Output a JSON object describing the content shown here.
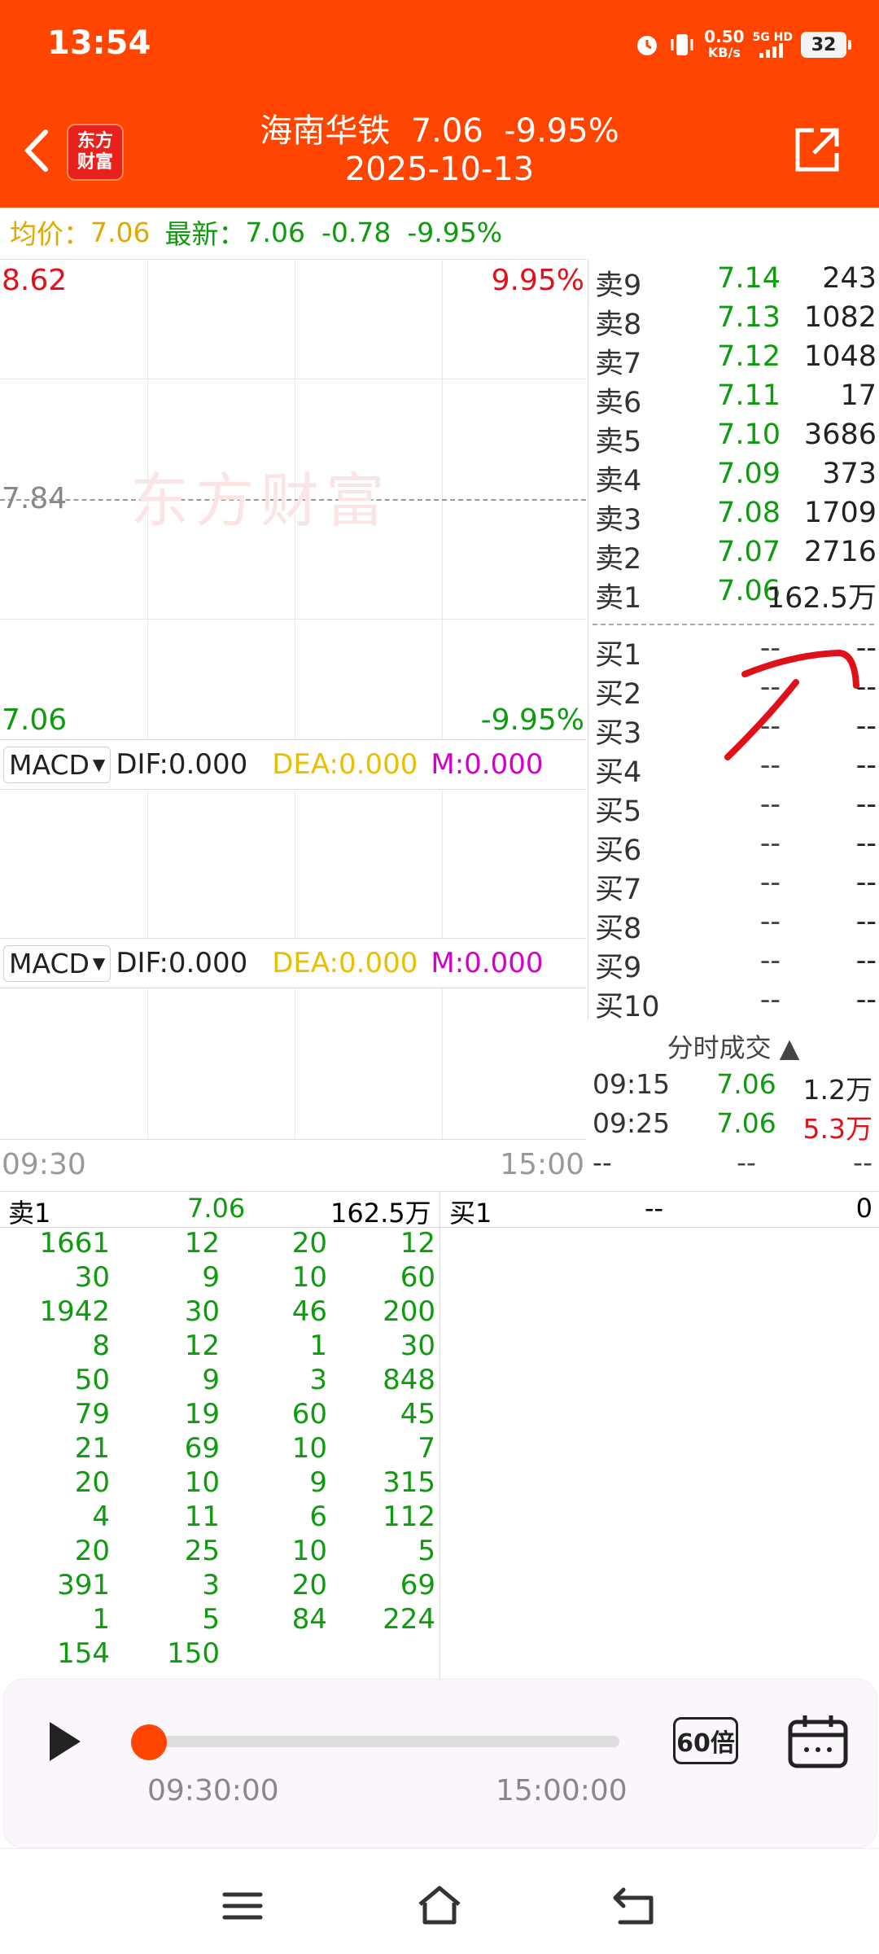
{
  "status": {
    "time": "13:54",
    "speed_top": "0.50",
    "speed_unit": "KB/s",
    "net": "5G HD",
    "battery": "32"
  },
  "header": {
    "logo_line1": "东方",
    "logo_line2": "财富",
    "title": "海南华铁  7.06  -9.95%",
    "date": "2025-10-13"
  },
  "info": {
    "avg_label": "均价：",
    "avg_value": "7.06",
    "latest_label": "最新：",
    "latest_value": "7.06",
    "change": "-0.78",
    "change_pct": "-9.95%"
  },
  "chart": {
    "price_high": "8.62",
    "pct_high": "9.95%",
    "price_mid": "7.84",
    "price_low": "7.06",
    "pct_low": "-9.95%",
    "watermark": "东方财富",
    "time_start": "09:30",
    "time_end": "15:00",
    "macd1": {
      "name": "MACD",
      "dif": "DIF:0.000",
      "dea": "DEA:0.000",
      "m": "M:0.000"
    },
    "macd2": {
      "name": "MACD",
      "dif": "DIF:0.000",
      "dea": "DEA:0.000",
      "m": "M:0.000"
    }
  },
  "order_book": {
    "asks": [
      {
        "label": "卖9",
        "price": "7.14",
        "vol": "243"
      },
      {
        "label": "卖8",
        "price": "7.13",
        "vol": "1082"
      },
      {
        "label": "卖7",
        "price": "7.12",
        "vol": "1048"
      },
      {
        "label": "卖6",
        "price": "7.11",
        "vol": "17"
      },
      {
        "label": "卖5",
        "price": "7.10",
        "vol": "3686"
      },
      {
        "label": "卖4",
        "price": "7.09",
        "vol": "373"
      },
      {
        "label": "卖3",
        "price": "7.08",
        "vol": "1709"
      },
      {
        "label": "卖2",
        "price": "7.07",
        "vol": "2716"
      },
      {
        "label": "卖1",
        "price": "7.06",
        "vol": "162.5万"
      }
    ],
    "bids": [
      {
        "label": "买1",
        "price": "--",
        "vol": "--"
      },
      {
        "label": "买2",
        "price": "--",
        "vol": "--"
      },
      {
        "label": "买3",
        "price": "--",
        "vol": "--"
      },
      {
        "label": "买4",
        "price": "--",
        "vol": "--"
      },
      {
        "label": "买5",
        "price": "--",
        "vol": "--"
      },
      {
        "label": "买6",
        "price": "--",
        "vol": "--"
      },
      {
        "label": "买7",
        "price": "--",
        "vol": "--"
      },
      {
        "label": "买8",
        "price": "--",
        "vol": "--"
      },
      {
        "label": "买9",
        "price": "--",
        "vol": "--"
      },
      {
        "label": "买10",
        "price": "--",
        "vol": "--"
      }
    ]
  },
  "trades": {
    "header": "分时成交",
    "rows": [
      {
        "time": "09:15",
        "price": "7.06",
        "vol": "1.2万"
      },
      {
        "time": "09:25",
        "price": "7.06",
        "vol": "5.3万"
      },
      {
        "time": "--",
        "price": "--",
        "vol": "--"
      }
    ]
  },
  "level2": {
    "sell_label": "卖1",
    "sell_price": "7.06",
    "sell_vol": "162.5万",
    "buy_label": "买1",
    "buy_price": "--",
    "buy_vol": "0",
    "queue": [
      [
        "1661",
        "12",
        "20",
        "12"
      ],
      [
        "30",
        "9",
        "10",
        "60"
      ],
      [
        "1942",
        "30",
        "46",
        "200"
      ],
      [
        "8",
        "12",
        "1",
        "30"
      ],
      [
        "50",
        "9",
        "3",
        "848"
      ],
      [
        "79",
        "19",
        "60",
        "45"
      ],
      [
        "21",
        "69",
        "10",
        "7"
      ],
      [
        "20",
        "10",
        "9",
        "315"
      ],
      [
        "4",
        "11",
        "6",
        "112"
      ],
      [
        "20",
        "25",
        "10",
        "5"
      ],
      [
        "391",
        "3",
        "20",
        "69"
      ],
      [
        "1",
        "5",
        "84",
        "224"
      ],
      [
        "154",
        "150",
        "",
        ""
      ]
    ]
  },
  "player": {
    "start_time": "09:30:00",
    "end_time": "15:00:00",
    "speed": "60倍",
    "progress": 0
  },
  "colors": {
    "brand": "#FF4500",
    "up": "#E3101A",
    "down": "#0E9B0E",
    "avg": "#E0A800",
    "m": "#D500C8",
    "annotation": "#E0101A"
  }
}
